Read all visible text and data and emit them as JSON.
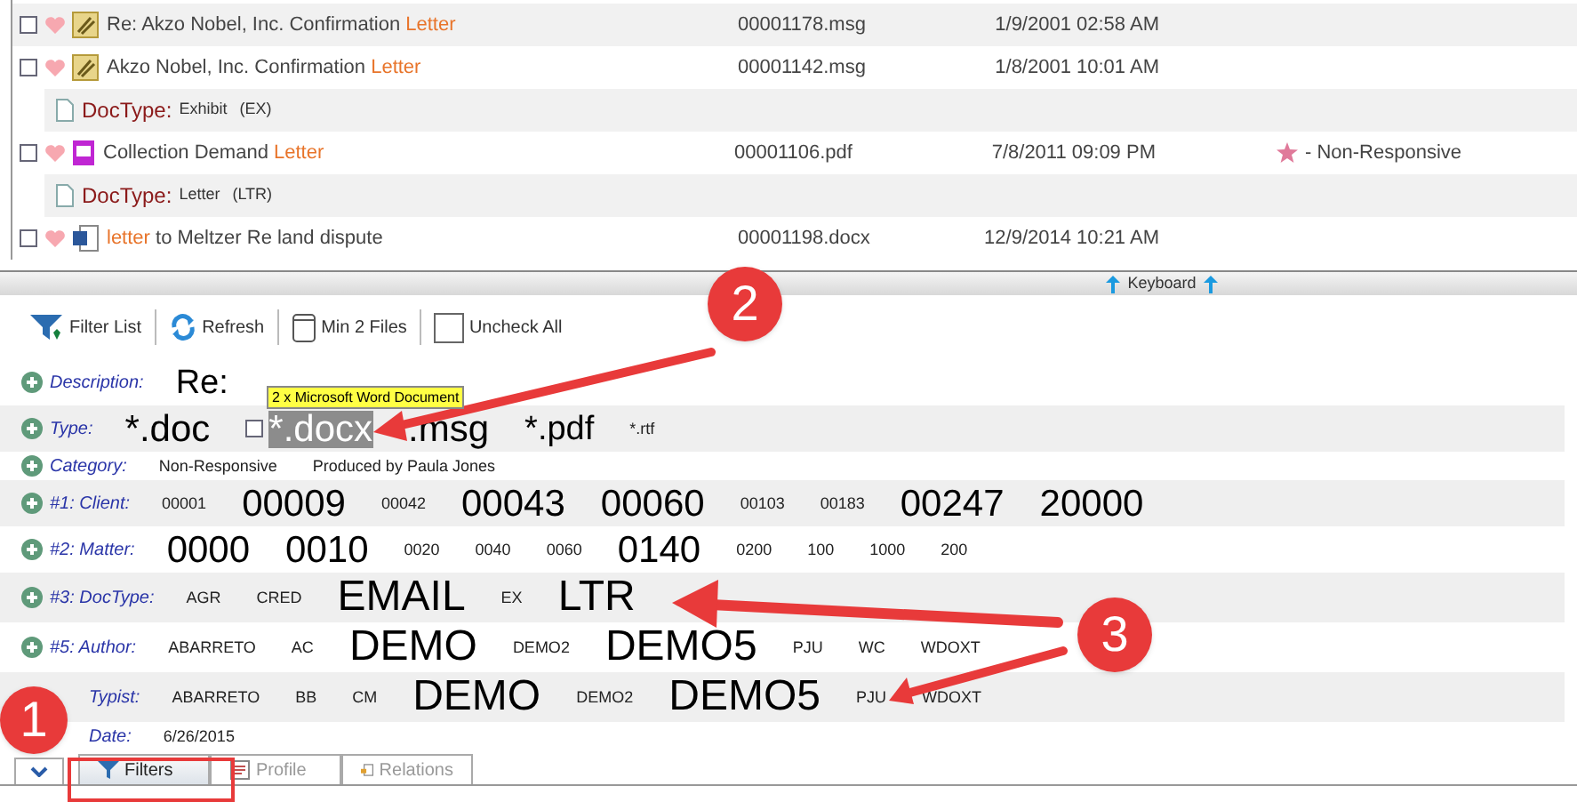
{
  "documents": [
    {
      "kind": "message",
      "checked": false,
      "title_parts": [
        {
          "text": "Re: Akzo Nobel, Inc. Confirmation ",
          "hit": false
        },
        {
          "text": "Letter",
          "hit": true
        }
      ],
      "file": "00001178.msg",
      "date": "1/9/2001 02:58 AM"
    },
    {
      "kind": "message",
      "checked": false,
      "title_parts": [
        {
          "text": "Akzo Nobel, Inc. Confirmation ",
          "hit": false
        },
        {
          "text": "Letter",
          "hit": true
        }
      ],
      "file": "00001142.msg",
      "date": "1/8/2001 10:01 AM"
    },
    {
      "kind": "doctype",
      "label": "DocType:",
      "value": "Exhibit",
      "code": "(EX)"
    },
    {
      "kind": "pdf",
      "checked": false,
      "title_parts": [
        {
          "text": "Collection Demand ",
          "hit": false
        },
        {
          "text": "Letter",
          "hit": true
        }
      ],
      "file": "00001106.pdf",
      "date": "7/8/2011 09:09 PM",
      "tag": "- Non-Responsive"
    },
    {
      "kind": "doctype",
      "label": "DocType:",
      "value": "Letter",
      "code": "(LTR)"
    },
    {
      "kind": "word",
      "checked": false,
      "title_parts": [
        {
          "text": "letter",
          "hit": true
        },
        {
          "text": " to Meltzer Re land dispute",
          "hit": false
        }
      ],
      "file": "00001198.docx",
      "date": "12/9/2014 10:21 AM"
    }
  ],
  "splitter": {
    "label": "Keyboard"
  },
  "toolbar": [
    {
      "kind": "filter",
      "label": "Filter List"
    },
    {
      "kind": "refresh",
      "label": "Refresh"
    },
    {
      "kind": "files",
      "label": "Min 2 Files"
    },
    {
      "kind": "check",
      "label": "Uncheck All"
    }
  ],
  "tooltip": "2 x Microsoft Word Document",
  "filters": [
    {
      "label": "Description:",
      "values": [
        {
          "text": "Re:",
          "kind": "medium"
        }
      ]
    },
    {
      "label": "Type:",
      "values": [
        {
          "text": "*.doc",
          "kind": "large",
          "selected": false
        },
        {
          "text": "*.docx",
          "kind": "large",
          "selected": true,
          "checked": false
        },
        {
          "text": ".msg",
          "kind": "large",
          "selected": false
        },
        {
          "text": "*.pdf",
          "kind": "medium",
          "selected": false
        },
        {
          "text": "*.rtf",
          "kind": "small",
          "selected": false
        }
      ]
    },
    {
      "label": "Category:",
      "values": [
        {
          "text": "Non-Responsive",
          "kind": "small"
        },
        {
          "text": "Produced by Paula Jones",
          "kind": "small"
        }
      ]
    },
    {
      "label": "#1: Client:",
      "values": [
        {
          "text": "00001",
          "kind": "small"
        },
        {
          "text": "00009",
          "kind": "large"
        },
        {
          "text": "00042",
          "kind": "small"
        },
        {
          "text": "00043",
          "kind": "large"
        },
        {
          "text": "00060",
          "kind": "large"
        },
        {
          "text": "00103",
          "kind": "small"
        },
        {
          "text": "00183",
          "kind": "small"
        },
        {
          "text": "00247",
          "kind": "large"
        },
        {
          "text": "20000",
          "kind": "large"
        }
      ]
    },
    {
      "label": "#2: Matter:",
      "values": [
        {
          "text": "0000",
          "kind": "large"
        },
        {
          "text": "0010",
          "kind": "large"
        },
        {
          "text": "0020",
          "kind": "small"
        },
        {
          "text": "0040",
          "kind": "small"
        },
        {
          "text": "0060",
          "kind": "small"
        },
        {
          "text": "0140",
          "kind": "large"
        },
        {
          "text": "0200",
          "kind": "small"
        },
        {
          "text": "100",
          "kind": "small"
        },
        {
          "text": "1000",
          "kind": "small"
        },
        {
          "text": "200",
          "kind": "small"
        }
      ]
    },
    {
      "label": "#3: DocType:",
      "values": [
        {
          "text": "AGR",
          "kind": "small"
        },
        {
          "text": "CRED",
          "kind": "small"
        },
        {
          "text": "EMAIL",
          "kind": "huge"
        },
        {
          "text": "EX",
          "kind": "small"
        },
        {
          "text": "LTR",
          "kind": "huge"
        }
      ]
    },
    {
      "label": "#5: Author:",
      "values": [
        {
          "text": "ABARRETO",
          "kind": "small"
        },
        {
          "text": "AC",
          "kind": "small"
        },
        {
          "text": "DEMO",
          "kind": "huge"
        },
        {
          "text": "DEMO2",
          "kind": "small"
        },
        {
          "text": "DEMO5",
          "kind": "huge"
        },
        {
          "text": "PJU",
          "kind": "small"
        },
        {
          "text": "WC",
          "kind": "small"
        },
        {
          "text": "WDOXT",
          "kind": "small"
        }
      ]
    },
    {
      "label": "Typist:",
      "values": [
        {
          "text": "ABARRETO",
          "kind": "small"
        },
        {
          "text": "BB",
          "kind": "small"
        },
        {
          "text": "CM",
          "kind": "small"
        },
        {
          "text": "DEMO",
          "kind": "huge"
        },
        {
          "text": "DEMO2",
          "kind": "small"
        },
        {
          "text": "DEMO5",
          "kind": "huge"
        },
        {
          "text": "PJU",
          "kind": "small"
        },
        {
          "text": "WDOXT",
          "kind": "small"
        }
      ]
    },
    {
      "label": "Date:",
      "values": [
        {
          "text": "6/26/2015",
          "kind": "small"
        }
      ]
    }
  ],
  "tabs": [
    {
      "kind": "filter",
      "label": "Filters",
      "selected": true
    },
    {
      "kind": "profile",
      "label": "Profile",
      "selected": false
    },
    {
      "kind": "relations",
      "label": "Relations",
      "selected": false
    }
  ],
  "annotations": [
    "1",
    "2",
    "3"
  ]
}
